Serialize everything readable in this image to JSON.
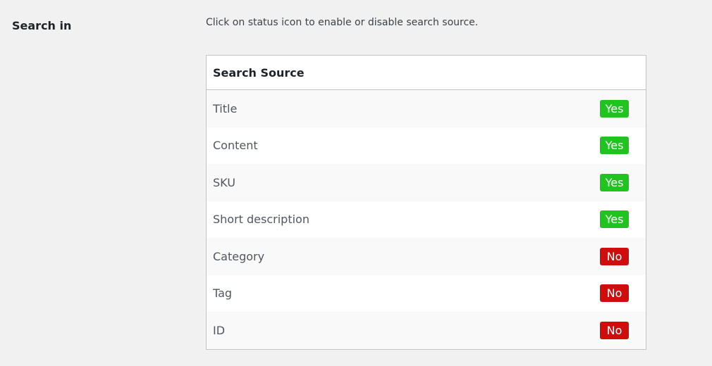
{
  "field": {
    "label": "Search in",
    "description": "Click on status icon to enable or disable search source."
  },
  "table": {
    "header": "Search Source",
    "rows": [
      {
        "source": "Title",
        "status": "Yes",
        "enabled": true
      },
      {
        "source": "Content",
        "status": "Yes",
        "enabled": true
      },
      {
        "source": "SKU",
        "status": "Yes",
        "enabled": true
      },
      {
        "source": "Short description",
        "status": "Yes",
        "enabled": true
      },
      {
        "source": "Category",
        "status": "No",
        "enabled": false
      },
      {
        "source": "Tag",
        "status": "No",
        "enabled": false
      },
      {
        "source": "ID",
        "status": "No",
        "enabled": false
      }
    ]
  },
  "colors": {
    "yes": "#1fc41f",
    "no": "#d00d0d"
  }
}
